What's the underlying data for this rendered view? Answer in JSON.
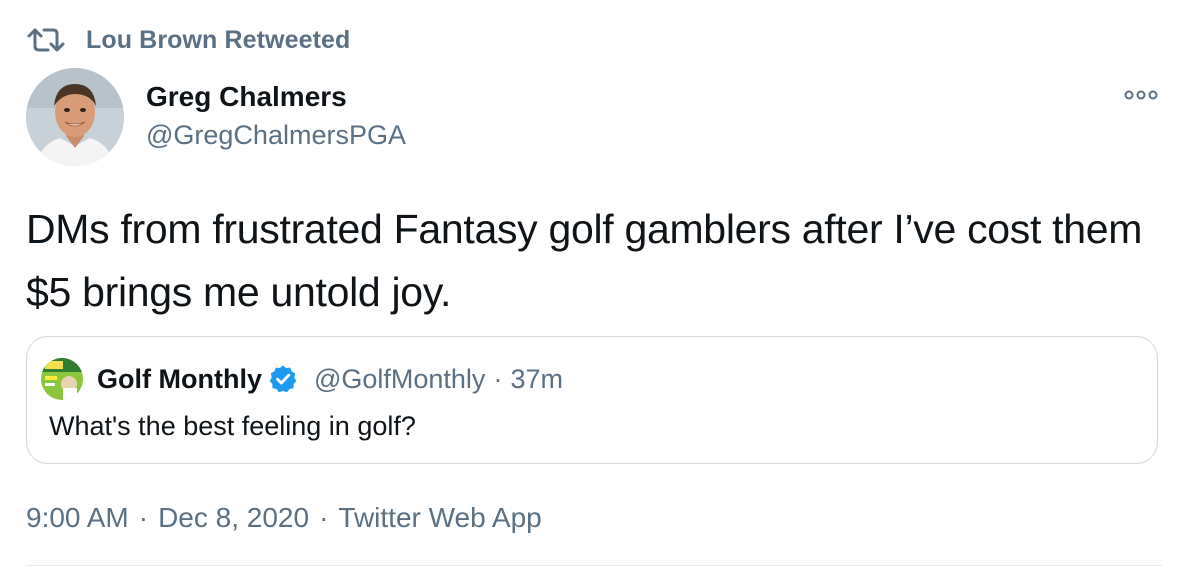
{
  "retweet": {
    "label": "Lou Brown Retweeted",
    "icon": "retweet-icon"
  },
  "author": {
    "name": "Greg Chalmers",
    "handle": "@GregChalmersPGA",
    "avatar": "avatar-photo"
  },
  "more_icon": "more-options-icon",
  "tweet": {
    "text": "DMs from frustrated Fantasy golf gamblers after I’ve cost them $5 brings me untold joy."
  },
  "quote": {
    "name": "Golf Monthly",
    "verified": true,
    "handle": "@GolfMonthly",
    "separator": "·",
    "time": "37m",
    "text": "What's the best feeling in golf?"
  },
  "meta": {
    "time": "9:00 AM",
    "separator": "·",
    "date": "Dec 8, 2020",
    "source": "Twitter Web App"
  },
  "colors": {
    "primary_text": "#0f1419",
    "secondary_text": "#5b7083",
    "verified_blue": "#1d9bf0",
    "border": "#cfd9de"
  }
}
